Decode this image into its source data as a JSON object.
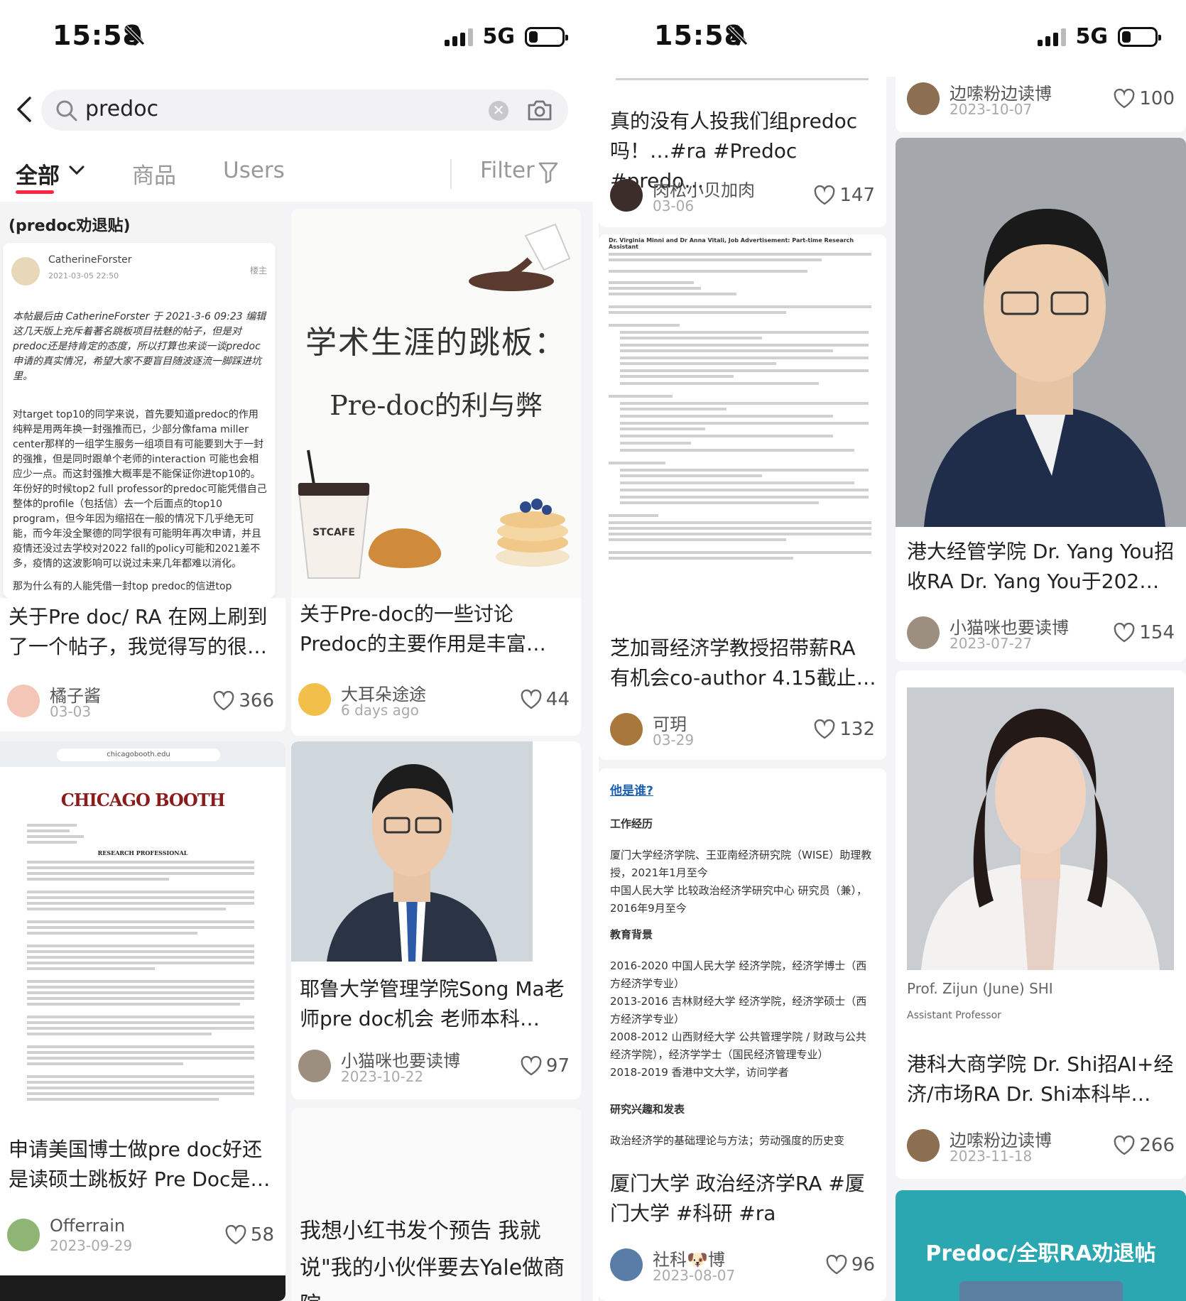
{
  "status_bar": {
    "time": "15:58",
    "network": "5G",
    "battery_level": 0.2
  },
  "search": {
    "value": "predoc"
  },
  "tabs": [
    {
      "label": "全部"
    },
    {
      "label": "商品"
    },
    {
      "label": "Users"
    }
  ],
  "filter": {
    "label": "Filter"
  },
  "left_header_banner": "(predoc劝退贴)",
  "left_cards": [
    {
      "title": "关于Pre doc/ RA 在网上刷到了一个帖子，我觉得写的很…",
      "author": "橘子酱",
      "date": "03-03",
      "likes": "366",
      "doc": {
        "forum_user": "CatherineForster",
        "forum_time": "2021-03-05 22:50",
        "forum_tag": "楼主",
        "p1": "本帖最后由 CatherineForster 于 2021-3-6 09:23 编辑 这几天版上充斥着著名跳板项目祛魅的帖子，但是对predoc还是持肯定的态度，所以打算也来谈一谈predoc申请的真实情况，希望大家不要盲目随波逐流一脚踩进坑里。",
        "p2": "对target top10的同学来说，首先要知道predoc的作用纯粹是用两年换一封强推而已，少部分像fama miller center那样的一组学生服务一组项目有可能要到大于一封的强推，但是同时跟单个老师的interaction 可能也会相应少一点。而这封强推大概率是不能保证你进top10的。年份好的时候top2 full professor的predoc可能凭借自己整体的profile（包括信）去一个后面点的top10 program，但今年因为缩招在一般的情况下几乎绝无可能，而今年没全聚德的同学很有可能明年再次申请，并且疫情还没过去学校对2022 fall的policy可能和2021差不多，疫情的这波影响可以说过未来几年都难以消化。",
        "p3": "那为什么有的人能凭借一封top predoc的信进top"
      }
    },
    {
      "title": "申请美国博士做pre doc好还是读硕士跳板好 Pre Doc是…",
      "author": "Offerrain",
      "date": "2023-09-29",
      "likes": "58",
      "doc": {
        "url": "chicagobooth.edu",
        "logo": "CHICAGO BOOTH",
        "heading": "RESEARCH PROFESSIONAL"
      }
    },
    {
      "title": "关于Pre-doc的一些讨论 Predoc的主要作用是丰富…",
      "author": "大耳朵途途",
      "date": "6 days ago",
      "likes": "44",
      "cover": {
        "line1": "学术生涯的跳板：",
        "line2": "Pre-doc的利与弊",
        "cup_text": "STCAFE"
      }
    },
    {
      "title": "耶鲁大学管理学院Song Ma老师pre doc机会 老师本科…",
      "author": "小猫咪也要读博",
      "date": "2023-10-22",
      "likes": "97"
    },
    {
      "title": "我想小红书发个预告 我就说\"我的小伙伴要去Yale做商院"
    }
  ],
  "right_cards": [
    {
      "title": "真的没有人投我们组predoc吗！…#ra #Predoc #predo…",
      "author": "肉松小贝加肉",
      "date": "03-06",
      "likes": "147"
    },
    {
      "title": "芝加哥经济学教授招带薪RA 有机会co-author 4.15截止…",
      "author": "可玥",
      "date": "03-29",
      "likes": "132",
      "doc": {
        "header": "Dr. Virginia Minni and Dr Anna Vitali, Job Advertisement: Part-time Research Assistant"
      }
    },
    {
      "title": "厦门大学 政治经济学RA #厦门大学 #科研 #ra",
      "author": "社科🐶博",
      "date": "2023-08-07",
      "likes": "96",
      "resume": {
        "who": "他是谁?",
        "h1": "工作经历",
        "w1": "厦门大学经济学院、王亚南经济研究院（WISE）助理教授，2021年1月至今",
        "w2": "中国人民大学 比较政治经济学研究中心 研究员（兼），2016年9月至今",
        "h2": "教育背景",
        "e1": "2016-2020 中国人民大学 经济学院，经济学博士（西方经济学专业）",
        "e2": "2013-2016 吉林财经大学 经济学院，经济学硕士（西方经济学专业）",
        "e3": "2008-2012 山西财经大学 公共管理学院 / 财政与公共经济学院），经济学学士（国民经济管理专业）",
        "e4": "2018-2019 香港中文大学，访问学者",
        "h3": "研究兴趣和发表",
        "r1": "政治经济学的基础理论与方法；劳动强度的历史变"
      }
    },
    {
      "author": "边嗦粉边读博",
      "date": "2023-10-07",
      "likes": "100"
    },
    {
      "title": "港大经管学院 Dr. Yang You招收RA Dr. Yang You于202…",
      "author": "小猫咪也要读博",
      "date": "2023-07-27",
      "likes": "154"
    },
    {
      "title": "港科大商学院 Dr. Shi招AI+经济/市场RA Dr. Shi本科毕…",
      "author": "边嗦粉边读博",
      "date": "2023-11-18",
      "likes": "266",
      "caption": {
        "name": "Prof. Zijun (June) SHI",
        "role": "Assistant Professor"
      }
    },
    {
      "banner": "Predoc/全职RA劝退帖"
    }
  ],
  "colors": {
    "accent": "#ff2442",
    "teal_banner": "#2aa7b0"
  },
  "icons": [
    "back-icon",
    "search-icon",
    "clear-icon",
    "camera-icon",
    "chevron-down-icon",
    "filter-icon",
    "heart-icon",
    "bell-off-icon"
  ]
}
